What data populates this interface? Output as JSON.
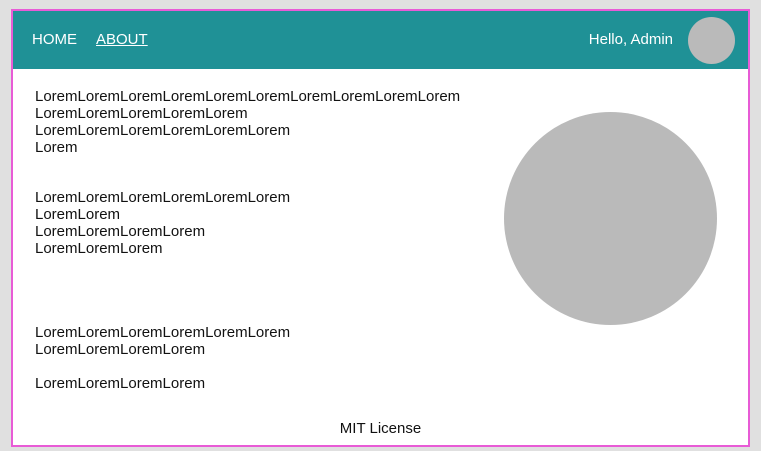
{
  "header": {
    "nav": {
      "home_label": "HOME",
      "about_label": "ABOUT"
    },
    "greeting": "Hello, Admin"
  },
  "main": {
    "block_1": [
      "LoremLoremLoremLoremLoremLoremLoremLoremLoremLorem",
      "LoremLoremLoremLoremLorem",
      "LoremLoremLoremLoremLoremLorem",
      "Lorem"
    ],
    "block_2": [
      "LoremLoremLoremLoremLoremLorem",
      "LoremLorem",
      "LoremLoremLoremLorem",
      "LoremLoremLorem"
    ],
    "block_3": [
      "LoremLoremLoremLoremLoremLorem",
      "LoremLoremLoremLorem"
    ],
    "block_4": [
      "LoremLoremLoremLorem"
    ]
  },
  "footer": {
    "license": "MIT License"
  },
  "colors": {
    "header_bg": "#1f9196",
    "frame_border": "#e85bd6",
    "placeholder_gray": "#bababa"
  }
}
